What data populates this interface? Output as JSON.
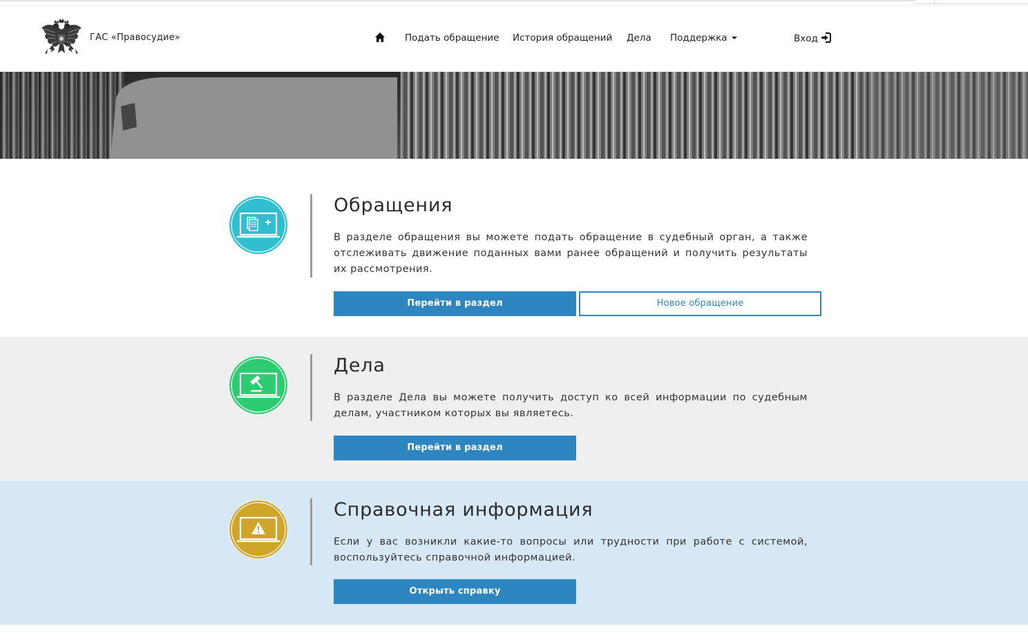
{
  "header": {
    "brand": "ГАС «Правосудие»",
    "nav": {
      "home_icon": "home-icon",
      "items": [
        "Подать обращение",
        "История обращений",
        "Дела"
      ],
      "support": "Поддержка",
      "login": "Вход"
    }
  },
  "sections": [
    {
      "title": "Обращения",
      "text": "В разделе обращения вы можете подать обращение в судебный орган, а также отслеживать движение поданных вами ранее обращений и получить результаты их рассмотрения.",
      "primary_button": "Перейти в раздел",
      "secondary_button": "Новое обращение",
      "icon": "laptop-document-icon",
      "color": "#30bfcf"
    },
    {
      "title": "Дела",
      "text": "В разделе Дела вы можете получить доступ ко всей информации по судебным делам, участником которых вы являетесь.",
      "primary_button": "Перейти в раздел",
      "icon": "laptop-gavel-icon",
      "color": "#2ecc71"
    },
    {
      "title": "Справочная информация",
      "text": "Если у вас возникли какие-то вопросы или трудности при работе с системой, воспользуйтесь справочной информацией.",
      "primary_button": "Открыть справку",
      "icon": "laptop-info-icon",
      "color": "#cfa52a"
    }
  ],
  "colors": {
    "primary": "#2e86c1",
    "section2_bg": "#efefef",
    "section3_bg": "#d6e7f5"
  }
}
